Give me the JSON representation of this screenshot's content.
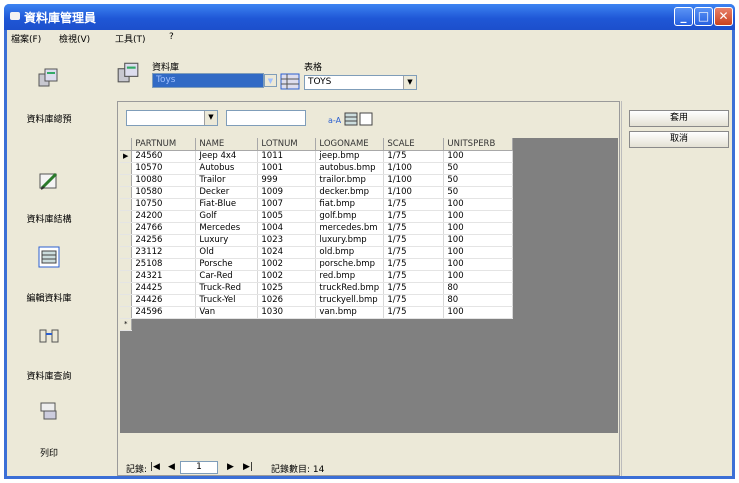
{
  "window": {
    "title": "資料庫管理員"
  },
  "menubar": [
    "檔案(F)",
    "檢視(V)",
    "工具(T)",
    "?"
  ],
  "sidebar": [
    {
      "label": "資料庫總預",
      "icon": "database-icon"
    },
    {
      "label": "資料庫結構",
      "icon": "edit-structure-icon"
    },
    {
      "label": "編輯資料庫",
      "icon": "table-edit-icon"
    },
    {
      "label": "資料庫查詢",
      "icon": "query-icon"
    },
    {
      "label": "列印",
      "icon": "print-icon"
    }
  ],
  "toolbar": {
    "database_label": "資料庫",
    "database_value": "Toys",
    "table_label": "表格",
    "table_value": "TOYS"
  },
  "grid": {
    "columns": [
      "PARTNUM",
      "NAME",
      "LOTNUM",
      "LOGONAME",
      "SCALE",
      "UNITSPERB"
    ],
    "rows": [
      [
        "24560",
        "Jeep 4x4",
        "1011",
        "jeep.bmp",
        "1/75",
        "100"
      ],
      [
        "10570",
        "Autobus",
        "1001",
        "autobus.bmp",
        "1/100",
        "50"
      ],
      [
        "10080",
        "Trailor",
        "999",
        "trailor.bmp",
        "1/100",
        "50"
      ],
      [
        "10580",
        "Decker",
        "1009",
        "decker.bmp",
        "1/100",
        "50"
      ],
      [
        "10750",
        "Fiat-Blue",
        "1007",
        "fiat.bmp",
        "1/75",
        "100"
      ],
      [
        "24200",
        "Golf",
        "1005",
        "golf.bmp",
        "1/75",
        "100"
      ],
      [
        "24766",
        "Mercedes",
        "1004",
        "mercedes.bm",
        "1/75",
        "100"
      ],
      [
        "24256",
        "Luxury",
        "1023",
        "luxury.bmp",
        "1/75",
        "100"
      ],
      [
        "23112",
        "Old",
        "1024",
        "old.bmp",
        "1/75",
        "100"
      ],
      [
        "25108",
        "Porsche",
        "1002",
        "porsche.bmp",
        "1/75",
        "100"
      ],
      [
        "24321",
        "Car-Red",
        "1002",
        "red.bmp",
        "1/75",
        "100"
      ],
      [
        "24425",
        "Truck-Red",
        "1025",
        "truckRed.bmp",
        "1/75",
        "80"
      ],
      [
        "24426",
        "Truck-Yel",
        "1026",
        "truckyell.bmp",
        "1/75",
        "80"
      ],
      [
        "24596",
        "Van",
        "1030",
        "van.bmp",
        "1/75",
        "100"
      ]
    ],
    "current_row_marker": "▶",
    "new_row_marker": "*"
  },
  "navigator": {
    "record_label": "記錄:",
    "current": "1",
    "count_label": "記錄數目: 14"
  },
  "actions": {
    "apply": "套用",
    "cancel": "取消"
  },
  "colors": {
    "titlebar": "#1f57d6",
    "selection": "#316ac5",
    "face": "#ece9d8"
  }
}
